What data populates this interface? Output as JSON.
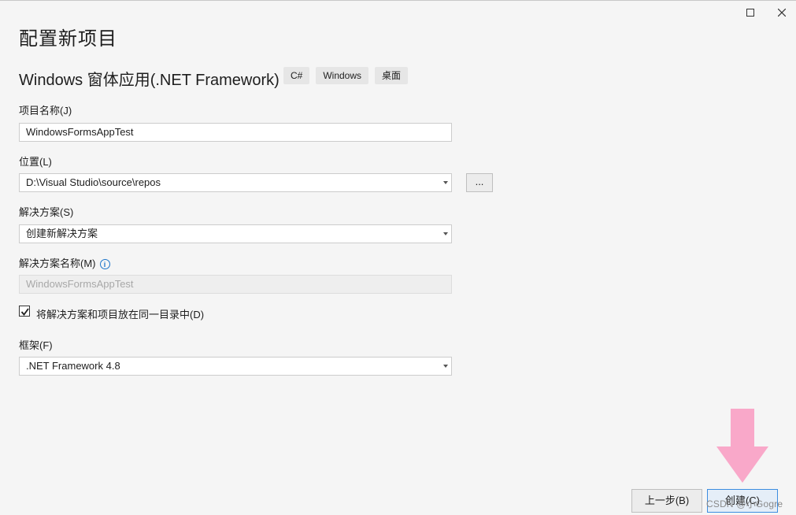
{
  "window": {
    "maximize_icon": "maximize-icon",
    "close_icon": "close-icon"
  },
  "page_title": "配置新项目",
  "template": {
    "name": "Windows 窗体应用(.NET Framework)",
    "tags": [
      "C#",
      "Windows",
      "桌面"
    ]
  },
  "form": {
    "project_name_label": "项目名称(J)",
    "project_name_value": "WindowsFormsAppTest",
    "location_label": "位置(L)",
    "location_value": "D:\\Visual Studio\\source\\repos",
    "browse_label": "...",
    "solution_label": "解决方案(S)",
    "solution_value": "创建新解决方案",
    "solution_name_label": "解决方案名称(M)",
    "solution_name_value": "WindowsFormsAppTest",
    "same_dir_label": "将解决方案和项目放在同一目录中(D)",
    "same_dir_checked": true,
    "framework_label": "框架(F)",
    "framework_value": ".NET Framework 4.8"
  },
  "buttons": {
    "back": "上一步(B)",
    "create": "创建(C)"
  },
  "watermark": "CSDN @小Gogre",
  "colors": {
    "arrow": "#f9a8c9",
    "info": "#1c74c9",
    "primary_border": "#3c8de0"
  }
}
